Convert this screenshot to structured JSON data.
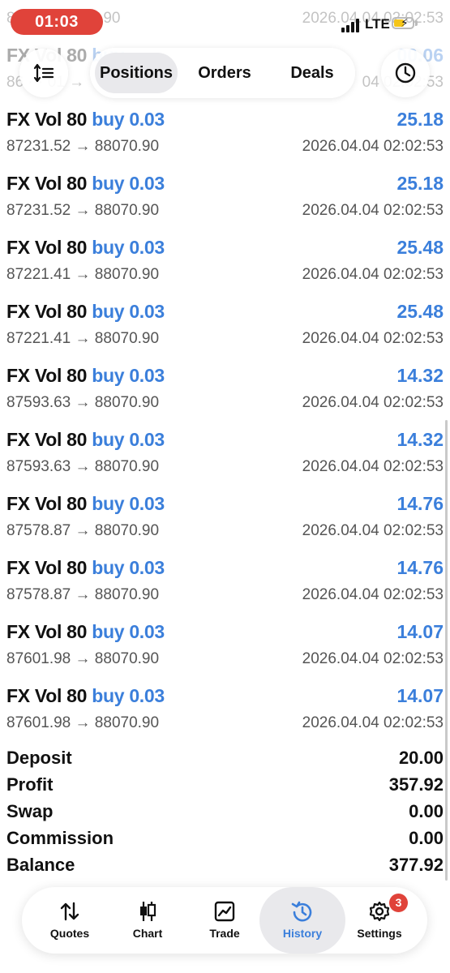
{
  "status_bar": {
    "time": "01:03",
    "network": "LTE"
  },
  "top_tabs": [
    "Positions",
    "Orders",
    "Deals"
  ],
  "partial_rows": [
    {
      "prices_prefix": "869",
      "prices_suffix": "88070.90",
      "date": "2026.04.04 02:02:53"
    },
    {
      "symbol": "FX Vol 80",
      "side": "buy",
      "profit": "00.06",
      "prices_prefix": "86",
      "prices_suffix": "01 →",
      "date": "04 02:02:53"
    }
  ],
  "deals": [
    {
      "symbol": "FX Vol 80",
      "side": "buy 0.03",
      "profit": "25.18",
      "prices": "87231.52 → 88070.90",
      "date": "2026.04.04 02:02:53"
    },
    {
      "symbol": "FX Vol 80",
      "side": "buy 0.03",
      "profit": "25.18",
      "prices": "87231.52 → 88070.90",
      "date": "2026.04.04 02:02:53"
    },
    {
      "symbol": "FX Vol 80",
      "side": "buy 0.03",
      "profit": "25.48",
      "prices": "87221.41 → 88070.90",
      "date": "2026.04.04 02:02:53"
    },
    {
      "symbol": "FX Vol 80",
      "side": "buy 0.03",
      "profit": "25.48",
      "prices": "87221.41 → 88070.90",
      "date": "2026.04.04 02:02:53"
    },
    {
      "symbol": "FX Vol 80",
      "side": "buy 0.03",
      "profit": "14.32",
      "prices": "87593.63 → 88070.90",
      "date": "2026.04.04 02:02:53"
    },
    {
      "symbol": "FX Vol 80",
      "side": "buy 0.03",
      "profit": "14.32",
      "prices": "87593.63 → 88070.90",
      "date": "2026.04.04 02:02:53"
    },
    {
      "symbol": "FX Vol 80",
      "side": "buy 0.03",
      "profit": "14.76",
      "prices": "87578.87 → 88070.90",
      "date": "2026.04.04 02:02:53"
    },
    {
      "symbol": "FX Vol 80",
      "side": "buy 0.03",
      "profit": "14.76",
      "prices": "87578.87 → 88070.90",
      "date": "2026.04.04 02:02:53"
    },
    {
      "symbol": "FX Vol 80",
      "side": "buy 0.03",
      "profit": "14.07",
      "prices": "87601.98 → 88070.90",
      "date": "2026.04.04 02:02:53"
    },
    {
      "symbol": "FX Vol 80",
      "side": "buy 0.03",
      "profit": "14.07",
      "prices": "87601.98 → 88070.90",
      "date": "2026.04.04 02:02:53"
    }
  ],
  "summary": [
    {
      "label": "Deposit",
      "value": "20.00"
    },
    {
      "label": "Profit",
      "value": "357.92"
    },
    {
      "label": "Swap",
      "value": "0.00"
    },
    {
      "label": "Commission",
      "value": "0.00"
    },
    {
      "label": "Balance",
      "value": "377.92"
    }
  ],
  "bottom_tabs": [
    {
      "label": "Quotes",
      "icon": "quotes-icon"
    },
    {
      "label": "Chart",
      "icon": "candlestick-icon"
    },
    {
      "label": "Trade",
      "icon": "trade-icon"
    },
    {
      "label": "History",
      "icon": "history-icon",
      "active": true
    },
    {
      "label": "Settings",
      "icon": "gear-icon",
      "badge": "3"
    }
  ],
  "colors": {
    "accent": "#3b7fdb",
    "time_pill": "#e0433a",
    "badge": "#e0433a"
  }
}
